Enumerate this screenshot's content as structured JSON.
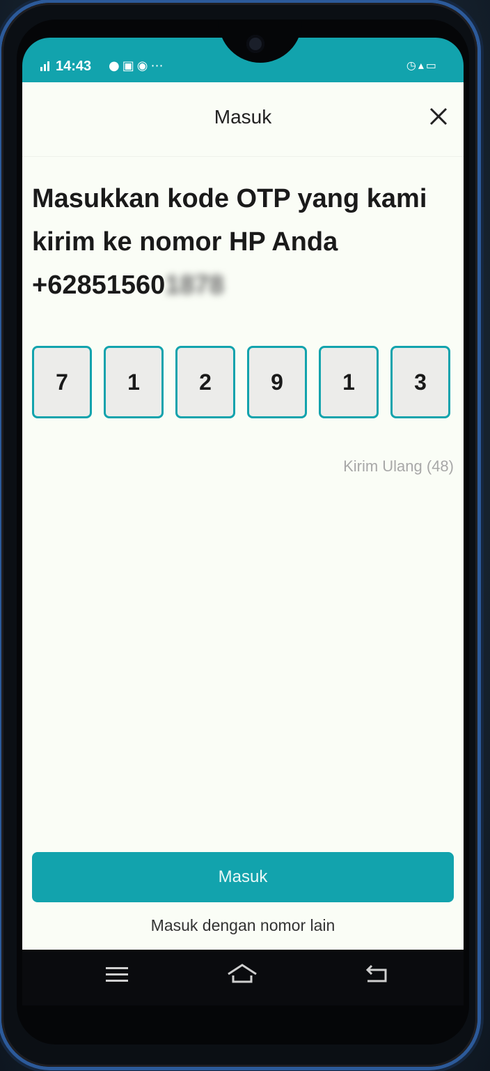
{
  "status_bar": {
    "time": "14:43",
    "signal_icon": "signal-icon",
    "left_icons": [
      "chat-icon",
      "gallery-icon",
      "record-icon",
      "more-icon"
    ],
    "right_icons": [
      "alarm-icon",
      "network-4g-icon",
      "battery-icon"
    ]
  },
  "header": {
    "title": "Masuk",
    "close_icon": "close-icon"
  },
  "prompt": {
    "text": "Masukkan kode OTP yang kami kirim ke nomor HP Anda +62851560",
    "redacted": "1878"
  },
  "otp": {
    "digits": [
      "7",
      "1",
      "2",
      "9",
      "1",
      "3"
    ]
  },
  "resend": {
    "label": "Kirim Ulang (48)"
  },
  "actions": {
    "submit_label": "Masuk",
    "alt_label": "Masuk dengan nomor lain"
  },
  "nav": {
    "menu_icon": "menu-icon",
    "home_icon": "home-icon",
    "back_icon": "back-icon"
  },
  "colors": {
    "accent": "#12a3ad",
    "background": "#fafdf6"
  }
}
